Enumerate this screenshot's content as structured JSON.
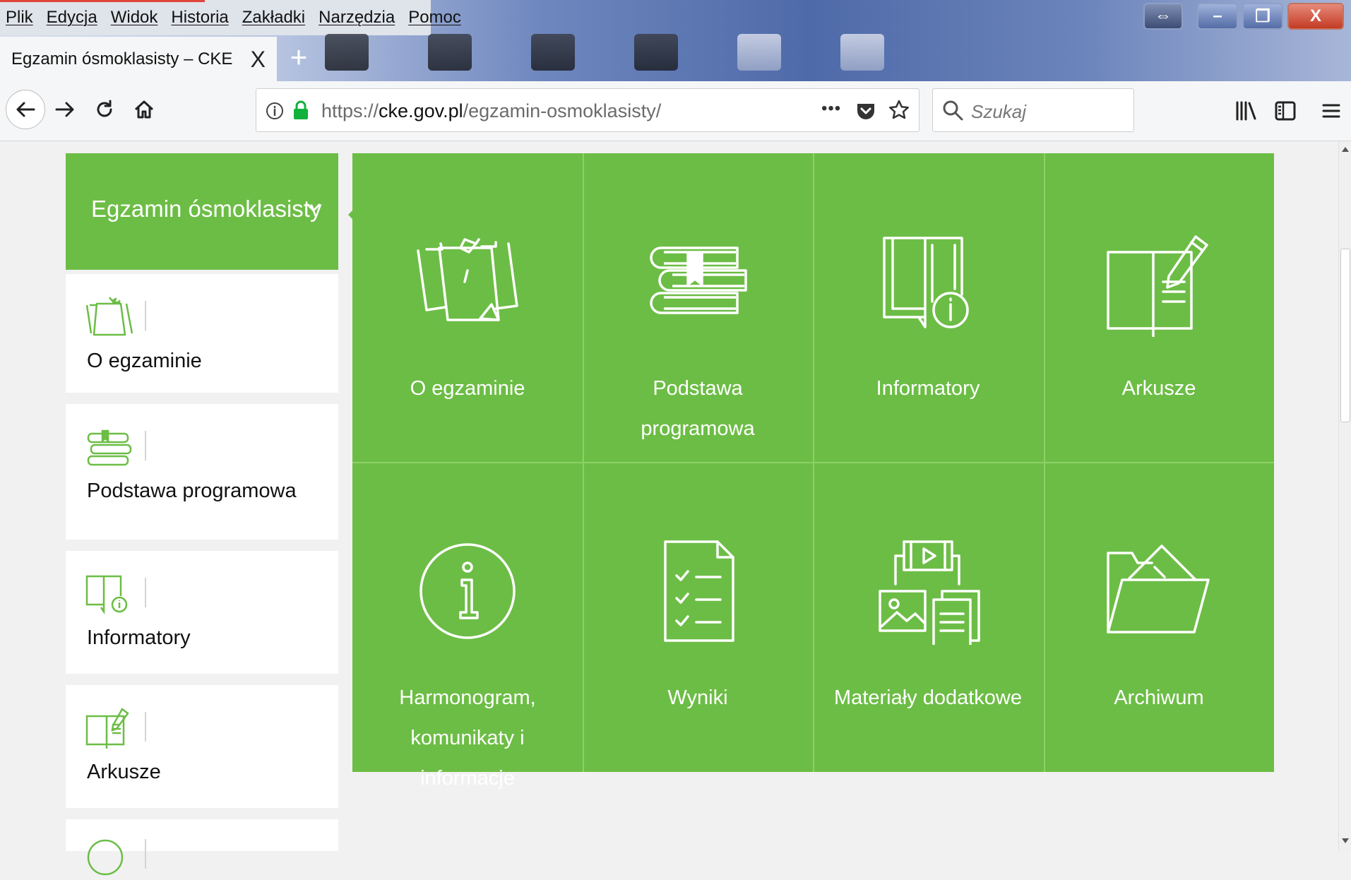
{
  "menu": [
    "Plik",
    "Edycja",
    "Widok",
    "Historia",
    "Zakładki",
    "Narzędzia",
    "Pomoc"
  ],
  "tab": {
    "title": "Egzamin ósmoklasisty – CKE",
    "close": "X",
    "new": "+"
  },
  "window_buttons": {
    "swap": "⇔",
    "minimize": "–",
    "maximize": "❐",
    "close": "X"
  },
  "address": {
    "scheme": "https://",
    "host": "cke.gov.pl",
    "path": "/egzamin-osmoklasisty/",
    "more": "•••"
  },
  "search": {
    "placeholder": "Szukaj"
  },
  "sidebar": {
    "header": "Egzamin ósmoklasisty",
    "items": [
      {
        "label": "O egzaminie",
        "icon": "notes-icon"
      },
      {
        "label": "Podstawa programowa",
        "icon": "books-icon"
      },
      {
        "label": "Informatory",
        "icon": "book-info-icon"
      },
      {
        "label": "Arkusze",
        "icon": "book-pencil-icon"
      }
    ]
  },
  "tiles": [
    {
      "label": "O egzaminie",
      "icon": "notes-icon"
    },
    {
      "label": "Podstawa programowa",
      "icon": "books-icon"
    },
    {
      "label": "Informatory",
      "icon": "book-info-icon"
    },
    {
      "label": "Arkusze",
      "icon": "book-pencil-icon"
    },
    {
      "label": "Harmonogram, komunikaty i informacje",
      "icon": "info-circle-icon"
    },
    {
      "label": "Wyniki",
      "icon": "checklist-icon"
    },
    {
      "label": "Materiały dodatkowe",
      "icon": "media-icon"
    },
    {
      "label": "Archiwum",
      "icon": "folder-icon"
    }
  ],
  "colors": {
    "accent": "#6cbd45",
    "tile_divider": "#8ed067",
    "page_bg": "#f1f1f1"
  }
}
